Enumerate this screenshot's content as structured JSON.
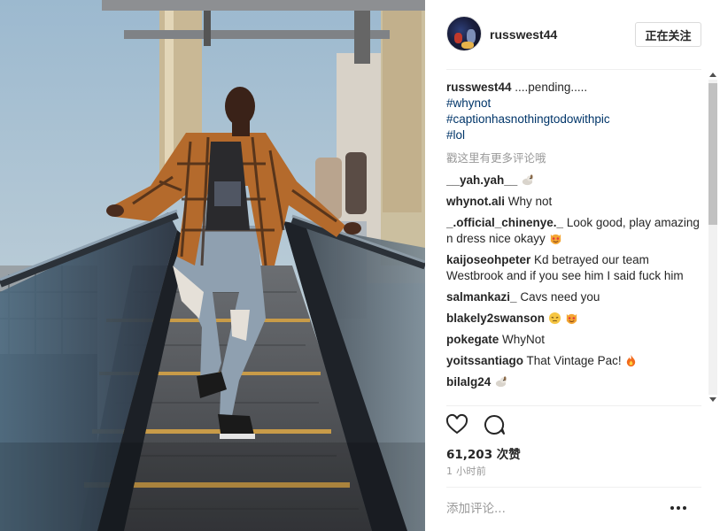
{
  "header": {
    "username": "russwest44",
    "follow_label": "正在关注"
  },
  "caption": {
    "username": "russwest44",
    "text": " ....pending.....",
    "hashtags": [
      "#whynot",
      "#captionhasnothingtodowithpic",
      "#lol"
    ]
  },
  "more_comments_label": "戳这里有更多评论哦",
  "comments": [
    {
      "username": "__yah.yah__",
      "text": " ",
      "emoji": "dog-emoji"
    },
    {
      "username": "whynot.ali",
      "text": " Why not",
      "emoji": ""
    },
    {
      "username": "_.official_chinenye._",
      "text": " Look good, play amazing n dress nice okayy",
      "emoji": "cat-heart-eyes-emoji"
    },
    {
      "username": "kaijoseohpeter",
      "text": " Kd betrayed our team Westbrook and if you see him I said fuck him",
      "emoji": ""
    },
    {
      "username": "salmankazi_",
      "text": " Cavs need you",
      "emoji": ""
    },
    {
      "username": "blakely2swanson",
      "text": " ",
      "emoji": "pensive-and-cat-emoji"
    },
    {
      "username": "pokegate",
      "text": " WhyNot",
      "emoji": ""
    },
    {
      "username": "yoitssantiago",
      "text": " That Vintage Pac! ",
      "emoji": "fire-emoji"
    },
    {
      "username": "bilalg24",
      "text": " ",
      "emoji": "dog-emoji"
    }
  ],
  "likes_label": "61,203 次赞",
  "time_label": "1 小时前",
  "add_comment_placeholder": "添加评论...",
  "icons": {
    "like": "heart-outline-icon",
    "comment": "speech-bubble-icon",
    "options": "more-options-icon"
  },
  "colors": {
    "hashtag": "#003569",
    "muted": "#999999",
    "text": "#262626"
  }
}
